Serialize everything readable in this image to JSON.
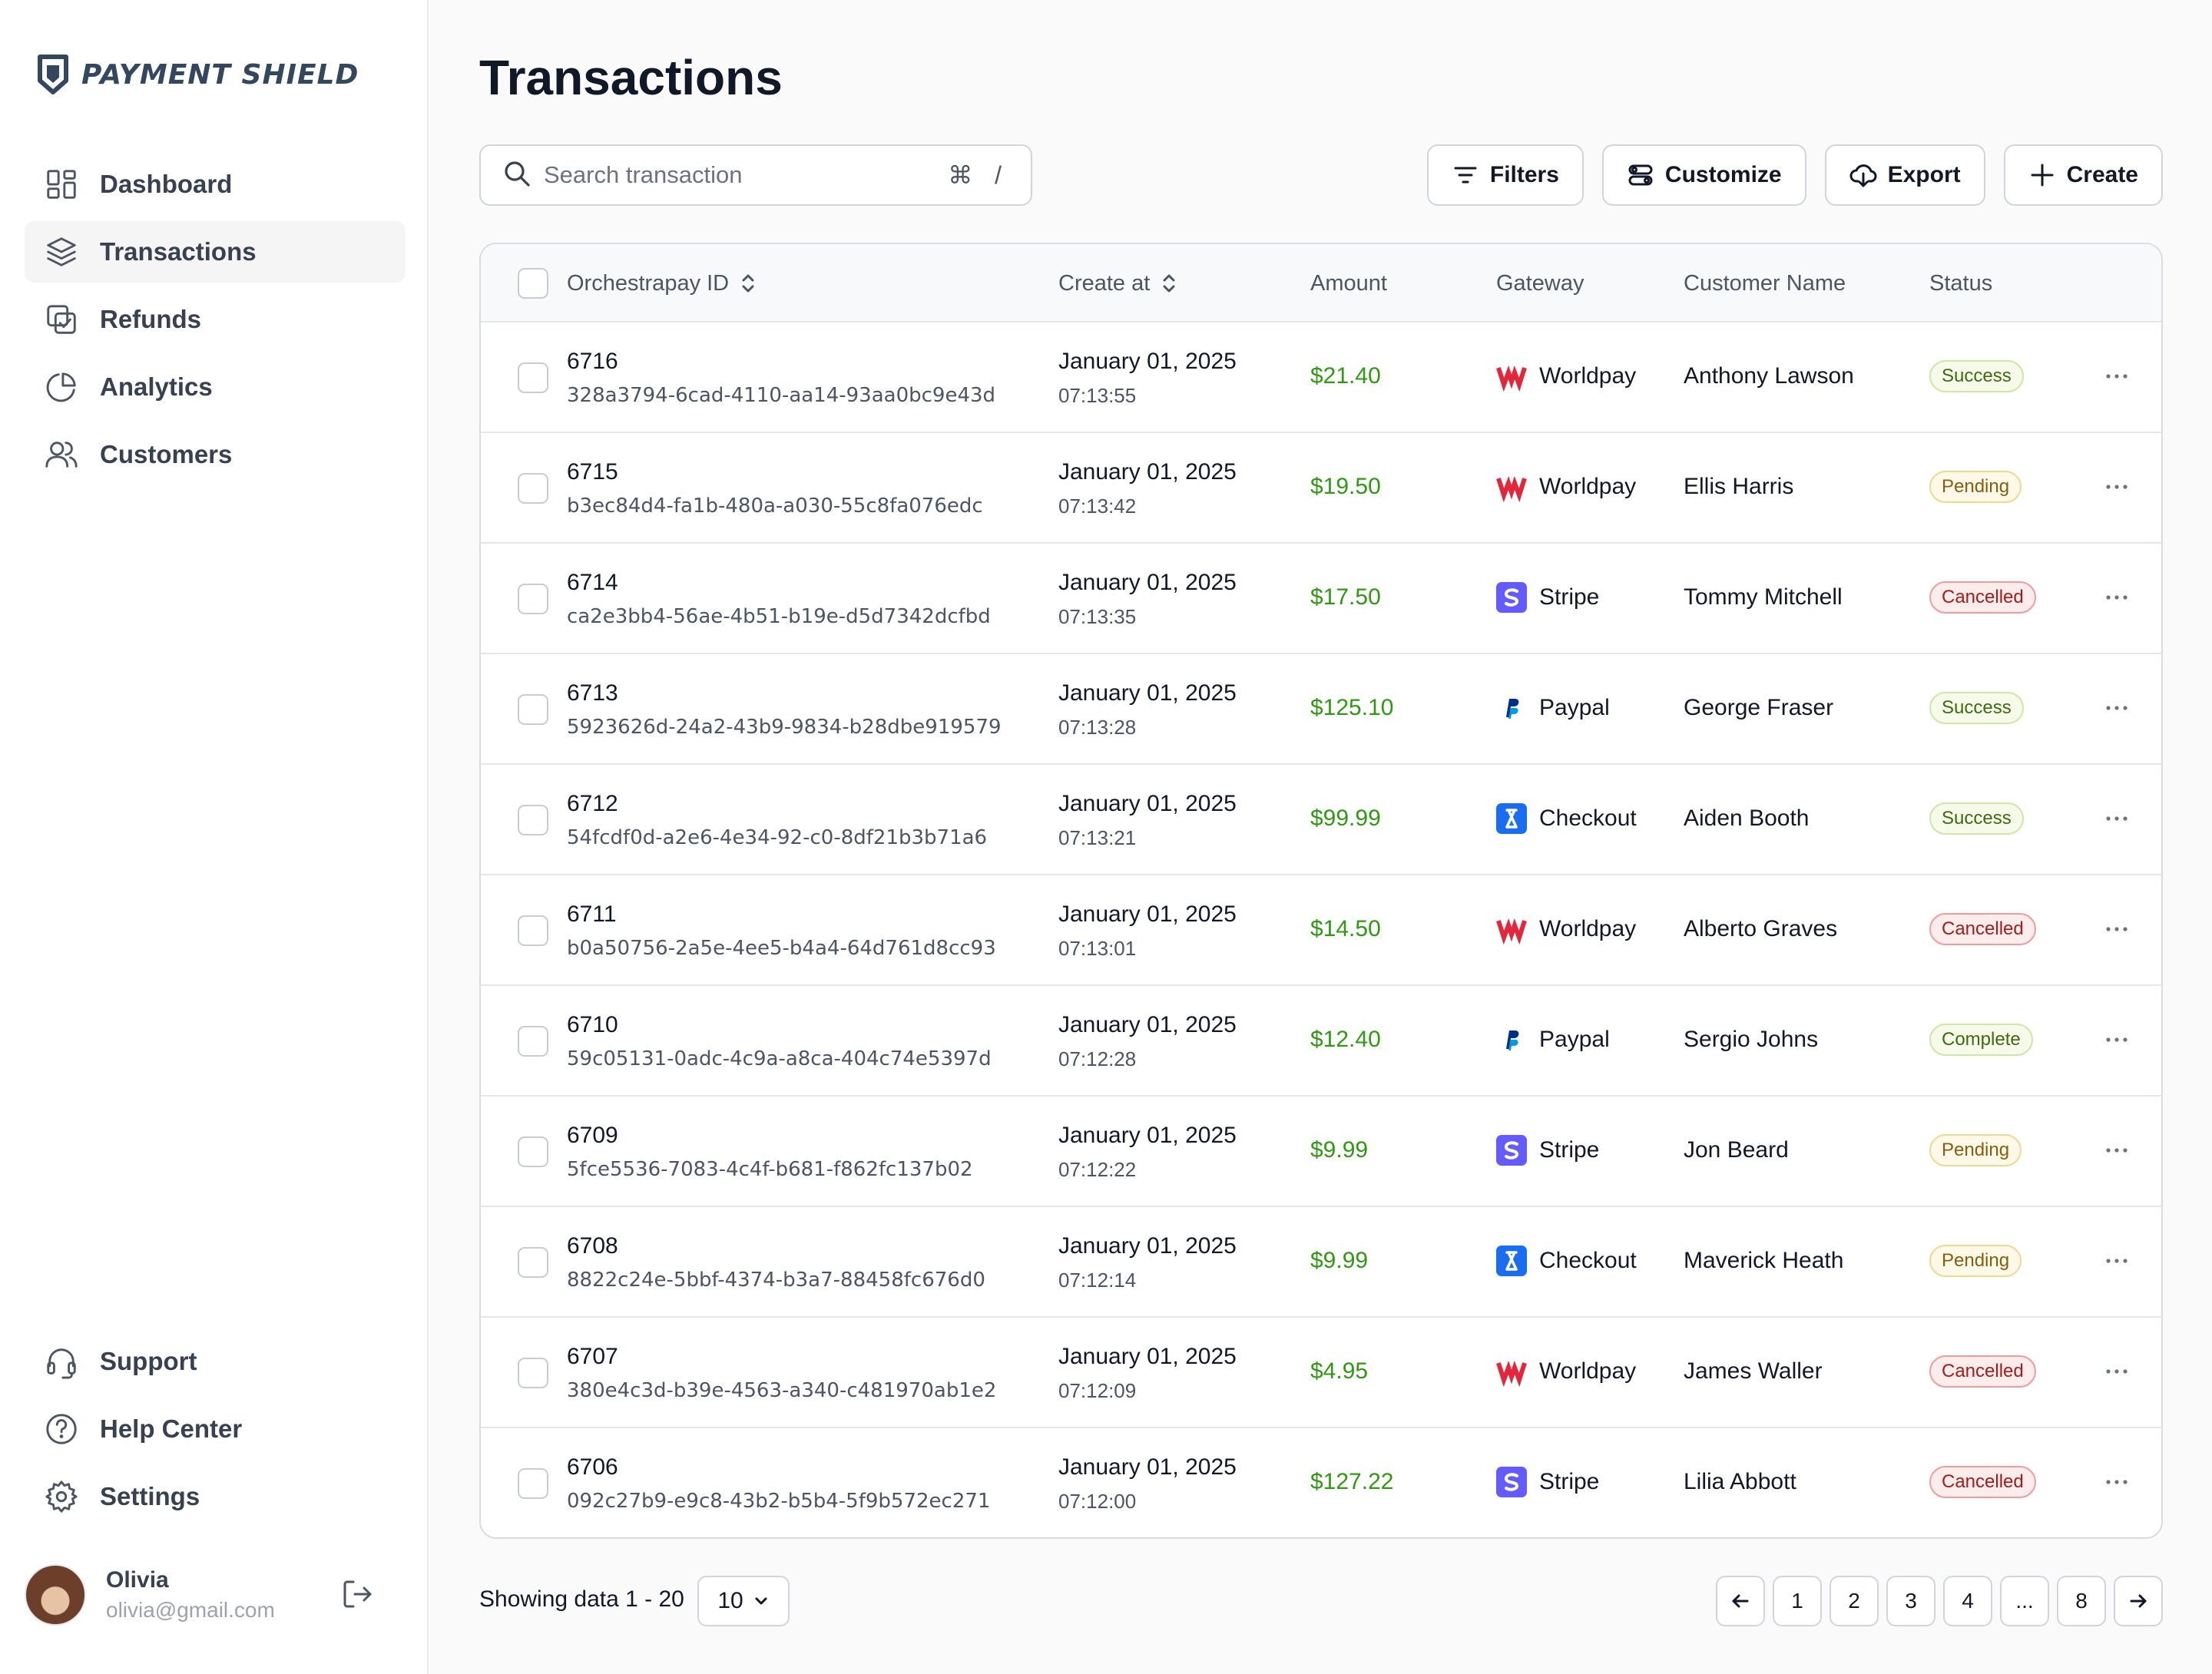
{
  "brand": {
    "name": "PAYMENT SHIELD"
  },
  "sidebar": {
    "items": [
      {
        "label": "Dashboard",
        "icon": "dashboard-icon"
      },
      {
        "label": "Transactions",
        "icon": "layers-icon",
        "active": true
      },
      {
        "label": "Refunds",
        "icon": "refund-icon"
      },
      {
        "label": "Analytics",
        "icon": "pie-chart-icon"
      },
      {
        "label": "Customers",
        "icon": "users-icon"
      }
    ],
    "bottom_items": [
      {
        "label": "Support",
        "icon": "headset-icon"
      },
      {
        "label": "Help Center",
        "icon": "help-circle-icon"
      },
      {
        "label": "Settings",
        "icon": "gear-icon"
      }
    ],
    "user": {
      "name": "Olivia",
      "email": "olivia@gmail.com"
    }
  },
  "page": {
    "title": "Transactions"
  },
  "search": {
    "placeholder": "Search transaction",
    "shortcut": "⌘ /"
  },
  "toolbar": {
    "filters": "Filters",
    "customize": "Customize",
    "export": "Export",
    "create": "Create"
  },
  "table": {
    "headers": {
      "id": "Orchestrapay ID",
      "created": "Create at",
      "amount": "Amount",
      "gateway": "Gateway",
      "customer": "Customer Name",
      "status": "Status"
    },
    "rows": [
      {
        "id": "6716",
        "uuid": "328a3794-6cad-4110-aa14-93aa0bc9e43d",
        "date": "January 01, 2025",
        "time": "07:13:55",
        "amount": "$21.40",
        "gateway": "Worldpay",
        "customer": "Anthony Lawson",
        "status": "Success"
      },
      {
        "id": "6715",
        "uuid": "b3ec84d4-fa1b-480a-a030-55c8fa076edc",
        "date": "January 01, 2025",
        "time": "07:13:42",
        "amount": "$19.50",
        "gateway": "Worldpay",
        "customer": "Ellis Harris",
        "status": "Pending"
      },
      {
        "id": "6714",
        "uuid": "ca2e3bb4-56ae-4b51-b19e-d5d7342dcfbd",
        "date": "January 01, 2025",
        "time": "07:13:35",
        "amount": "$17.50",
        "gateway": "Stripe",
        "customer": "Tommy Mitchell",
        "status": "Cancelled"
      },
      {
        "id": "6713",
        "uuid": "5923626d-24a2-43b9-9834-b28dbe919579",
        "date": "January 01, 2025",
        "time": "07:13:28",
        "amount": "$125.10",
        "gateway": "Paypal",
        "customer": "George Fraser",
        "status": "Success"
      },
      {
        "id": "6712",
        "uuid": "54fcdf0d-a2e6-4e34-92-c0-8df21b3b71a6",
        "date": "January 01, 2025",
        "time": "07:13:21",
        "amount": "$99.99",
        "gateway": "Checkout",
        "customer": "Aiden Booth",
        "status": "Success"
      },
      {
        "id": "6711",
        "uuid": "b0a50756-2a5e-4ee5-b4a4-64d761d8cc93",
        "date": "January 01, 2025",
        "time": "07:13:01",
        "amount": "$14.50",
        "gateway": "Worldpay",
        "customer": "Alberto Graves",
        "status": "Cancelled"
      },
      {
        "id": "6710",
        "uuid": "59c05131-0adc-4c9a-a8ca-404c74e5397d",
        "date": "January 01, 2025",
        "time": "07:12:28",
        "amount": "$12.40",
        "gateway": "Paypal",
        "customer": "Sergio Johns",
        "status": "Complete"
      },
      {
        "id": "6709",
        "uuid": "5fce5536-7083-4c4f-b681-f862fc137b02",
        "date": "January 01, 2025",
        "time": "07:12:22",
        "amount": "$9.99",
        "gateway": "Stripe",
        "customer": "Jon Beard",
        "status": "Pending"
      },
      {
        "id": "6708",
        "uuid": "8822c24e-5bbf-4374-b3a7-88458fc676d0",
        "date": "January 01, 2025",
        "time": "07:12:14",
        "amount": "$9.99",
        "gateway": "Checkout",
        "customer": "Maverick Heath",
        "status": "Pending"
      },
      {
        "id": "6707",
        "uuid": "380e4c3d-b39e-4563-a340-c481970ab1e2",
        "date": "January 01, 2025",
        "time": "07:12:09",
        "amount": "$4.95",
        "gateway": "Worldpay",
        "customer": "James Waller",
        "status": "Cancelled"
      },
      {
        "id": "6706",
        "uuid": "092c27b9-e9c8-43b2-b5b4-5f9b572ec271",
        "date": "January 01, 2025",
        "time": "07:12:00",
        "amount": "$127.22",
        "gateway": "Stripe",
        "customer": "Lilia Abbott",
        "status": "Cancelled"
      }
    ]
  },
  "footer": {
    "showing": "Showing data 1 - 20",
    "per_page": "10",
    "pages": [
      "1",
      "2",
      "3",
      "4",
      "...",
      "8"
    ]
  },
  "colors": {
    "amount": "#2f9a11",
    "brand": "#33475f",
    "worldpay": "#e3263a",
    "stripe": "#635bff",
    "checkout": "#1a6cf0",
    "paypal": "#003087"
  }
}
